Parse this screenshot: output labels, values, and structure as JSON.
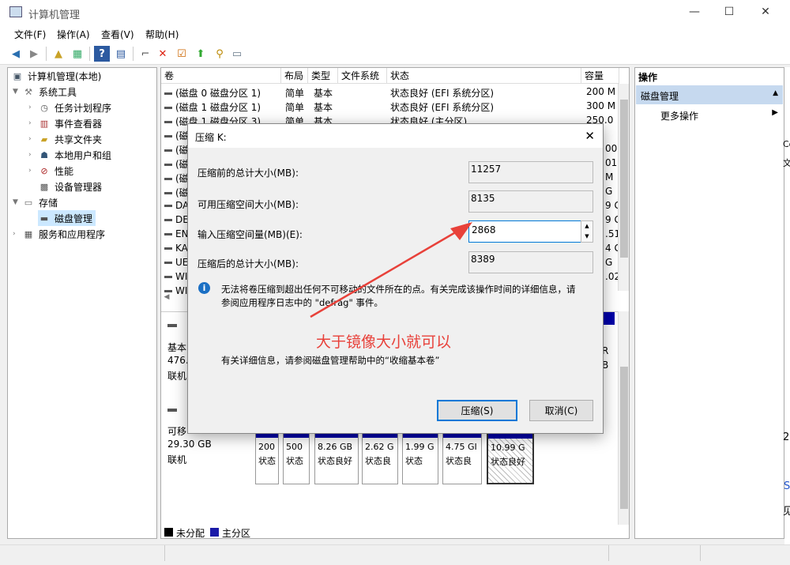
{
  "window": {
    "title": "计算机管理",
    "minimize": "—",
    "maximize": "☐",
    "close": "✕"
  },
  "menu": [
    "文件(F)",
    "操作(A)",
    "查看(V)",
    "帮助(H)"
  ],
  "tree": {
    "root": "计算机管理(本地)",
    "system_tools": "系统工具",
    "task_scheduler": "任务计划程序",
    "event_viewer": "事件查看器",
    "shared_folders": "共享文件夹",
    "local_users": "本地用户和组",
    "performance": "性能",
    "device_manager": "设备管理器",
    "storage": "存储",
    "disk_management": "磁盘管理",
    "services_apps": "服务和应用程序"
  },
  "volume_table": {
    "headers": [
      "卷",
      "布局",
      "类型",
      "文件系统",
      "状态",
      "容量"
    ],
    "rows": [
      {
        "vol": "(磁盘 0 磁盘分区 1)",
        "layout": "简单",
        "type": "基本",
        "fs": "",
        "status": "状态良好 (EFI 系统分区)",
        "cap": "200 M"
      },
      {
        "vol": "(磁盘 1 磁盘分区 1)",
        "layout": "简单",
        "type": "基本",
        "fs": "",
        "status": "状态良好 (EFI 系统分区)",
        "cap": "300 M"
      },
      {
        "vol": "(磁盘 1 磁盘分区 3)",
        "layout": "简单",
        "type": "基本",
        "fs": "",
        "status": "状态良好 (主分区)",
        "cap": "250.0"
      }
    ],
    "hidden_row_fragments": [
      "(磁",
      "(磁",
      "(磁",
      "(磁",
      "(磁",
      "DA",
      "DE",
      "EN",
      "KA",
      "UE",
      "WI",
      "WI"
    ],
    "cap_fragments": [
      "00",
      "01",
      "M",
      "G",
      "9 G",
      "9 G",
      ".51",
      "4 G",
      "G",
      ".02"
    ]
  },
  "disks": {
    "disk_a": {
      "line1": "基本",
      "line2": "476.",
      "line3": "联机"
    },
    "disk_b": {
      "line1": "可移",
      "line2": "29.30 GB",
      "line3": "联机"
    },
    "volumes": [
      {
        "size": "200",
        "status": "状态"
      },
      {
        "size": "500",
        "status": "状态"
      },
      {
        "size": "8.26 GB",
        "status": "状态良好"
      },
      {
        "size": "2.62 G",
        "status": "状态良"
      },
      {
        "size": "1.99 G",
        "status": "状态"
      },
      {
        "size": "4.75 GI",
        "status": "状态良"
      },
      {
        "size": "10.99 G",
        "status": "状态良好"
      }
    ],
    "right_fragments": [
      "R",
      "B"
    ]
  },
  "legend": {
    "unallocated": "未分配",
    "primary": "主分区"
  },
  "actions": {
    "header": "操作",
    "section": "磁盘管理",
    "more": "更多操作"
  },
  "dialog": {
    "title": "压缩 K:",
    "total_before_label": "压缩前的总计大小(MB):",
    "total_before_value": "11257",
    "available_label": "可用压缩空间大小(MB):",
    "available_value": "8135",
    "input_label": "输入压缩空间量(MB)(E):",
    "input_value": "2868",
    "total_after_label": "压缩后的总计大小(MB):",
    "total_after_value": "8389",
    "info_text_1": "无法将卷压缩到超出任何不可移动的文件所在的点。有关完成该操作时间的详细信息，请",
    "info_text_2": "参阅应用程序日志中的 \"defrag\" 事件。",
    "help_text": "有关详细信息，请参阅磁盘管理帮助中的“收缩基本卷”",
    "shrink_button": "压缩(S)",
    "cancel_button": "取消(C)"
  },
  "annotation": {
    "text": "大于镜像大小就可以",
    "color": "#e8413a"
  },
  "background_fragments": [
    "Co",
    "文",
    "2(",
    "S",
    "见"
  ]
}
